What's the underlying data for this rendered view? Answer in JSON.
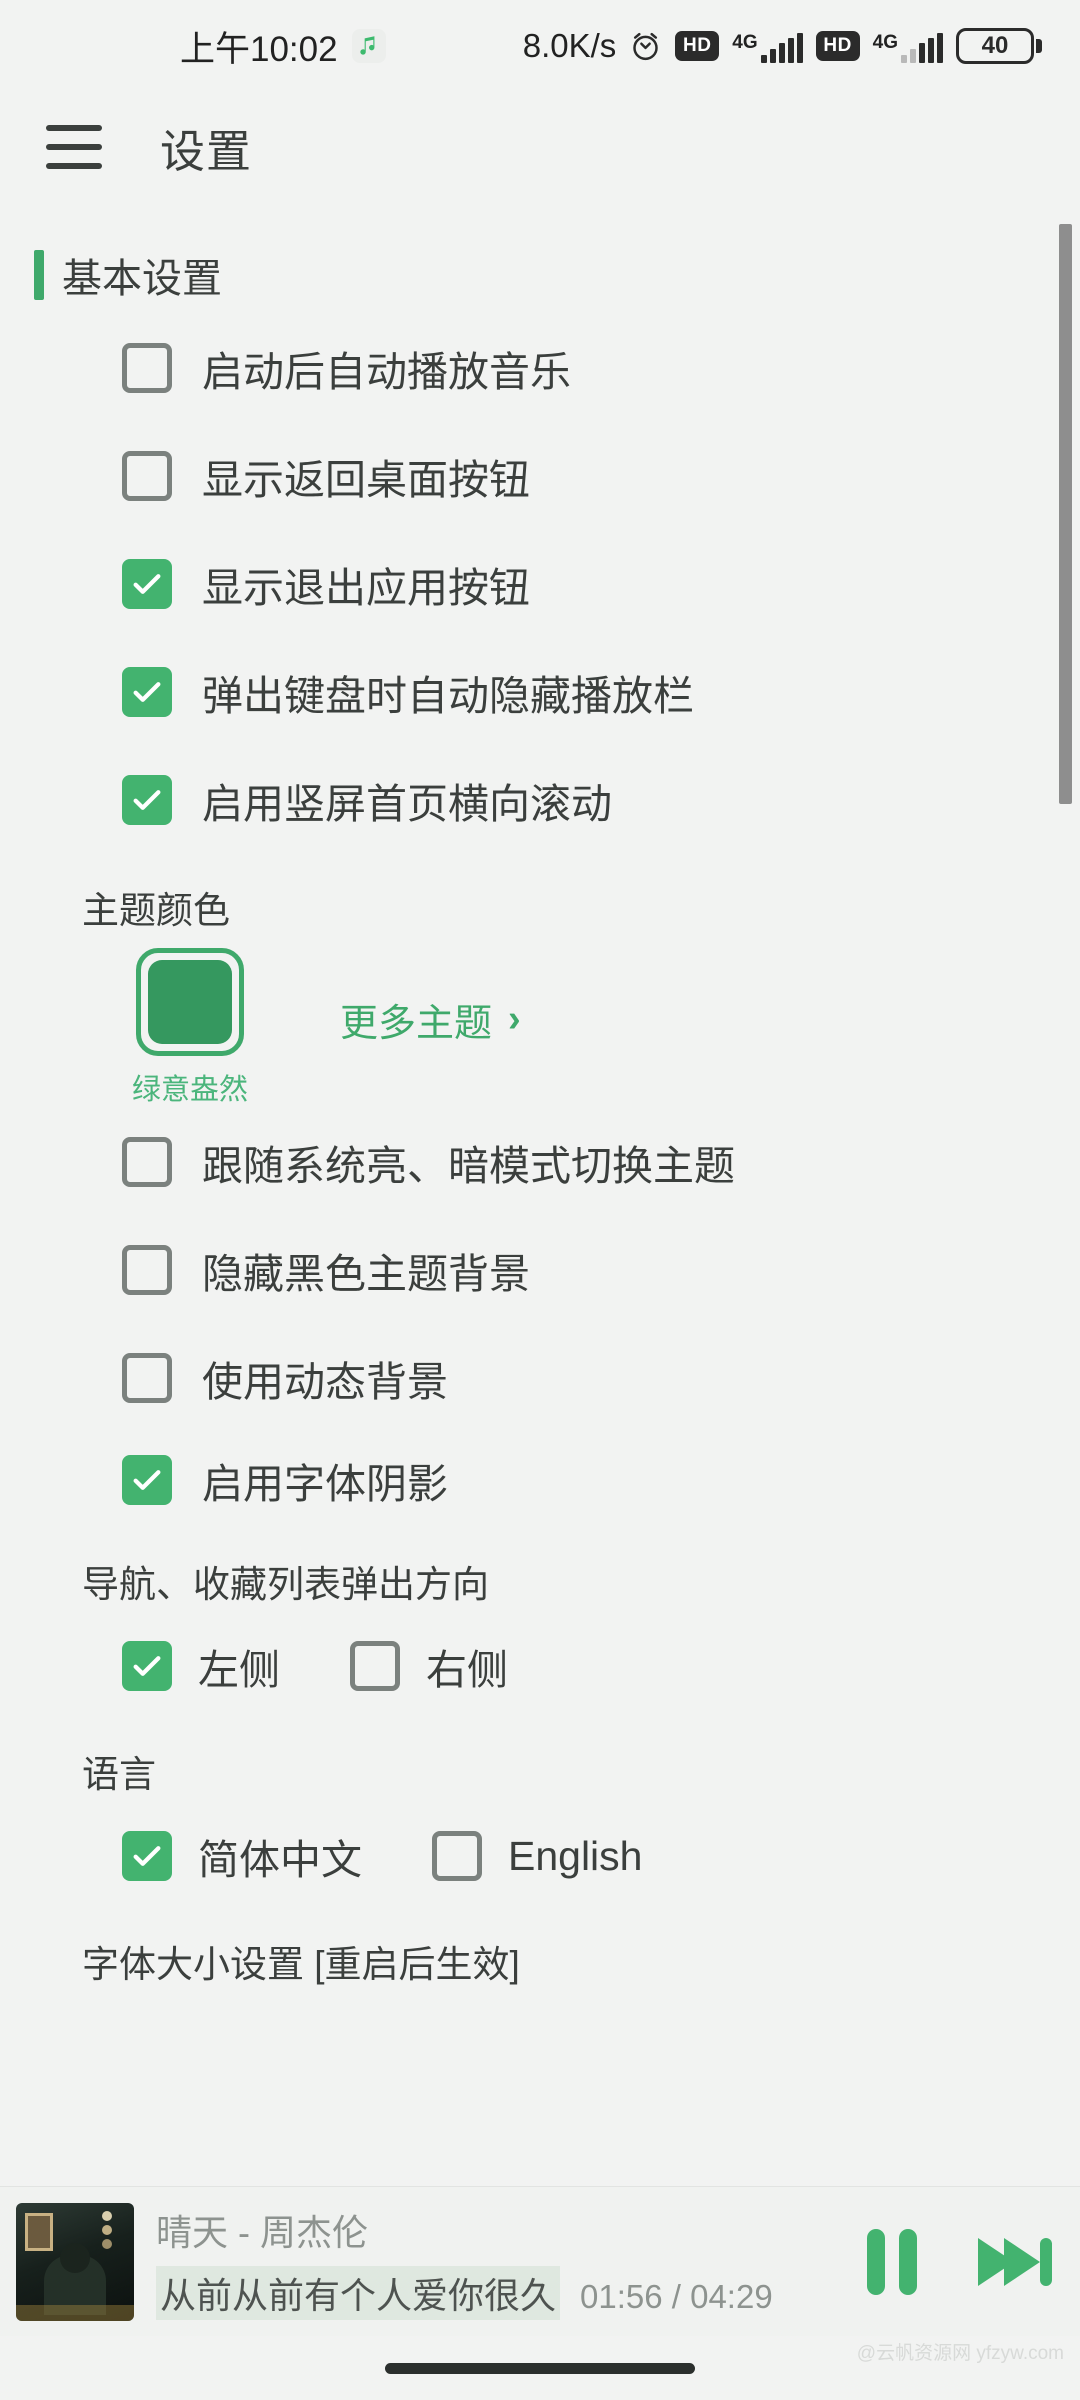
{
  "statusbar": {
    "time": "上午10:02",
    "music_icon": "music-note-icon",
    "net_speed": "8.0K/s",
    "alarm_icon": "alarm-clock-icon",
    "sim1_hd": "HD",
    "sim1_network": "4G",
    "sim2_hd": "HD",
    "sim2_network": "4G",
    "battery_level": "40"
  },
  "appbar": {
    "menu_icon": "hamburger-menu-icon",
    "title": "设置"
  },
  "section": {
    "title": "基本设置"
  },
  "basic_items": [
    {
      "label": "启动后自动播放音乐",
      "checked": false
    },
    {
      "label": "显示返回桌面按钮",
      "checked": false
    },
    {
      "label": "显示退出应用按钮",
      "checked": true
    },
    {
      "label": "弹出键盘时自动隐藏播放栏",
      "checked": true
    },
    {
      "label": "启用竖屏首页横向滚动",
      "checked": true
    }
  ],
  "theme": {
    "group_label": "主题颜色",
    "swatch_color": "#35985f",
    "swatch_name": "绿意盎然",
    "more_label": "更多主题",
    "chevron": "›"
  },
  "theme_items": [
    {
      "label": "跟随系统亮、暗模式切换主题",
      "checked": false
    },
    {
      "label": "隐藏黑色主题背景",
      "checked": false
    },
    {
      "label": "使用动态背景",
      "checked": false
    },
    {
      "label": "启用字体阴影",
      "checked": true
    }
  ],
  "popup_direction": {
    "group_label": "导航、收藏列表弹出方向",
    "options": [
      {
        "label": "左侧",
        "checked": true
      },
      {
        "label": "右侧",
        "checked": false
      }
    ]
  },
  "language": {
    "group_label": "语言",
    "options": [
      {
        "label": "简体中文",
        "checked": true
      },
      {
        "label": "English",
        "checked": false
      }
    ]
  },
  "font_size": {
    "group_label": "字体大小设置 [重启后生效]"
  },
  "player": {
    "album_art": "album-cover-art",
    "track": "晴天 - 周杰伦",
    "lyric": "从前从前有个人爱你很久",
    "time": "01:56 / 04:29",
    "pause_icon": "pause-icon",
    "next_icon": "next-track-icon"
  },
  "watermark": "@云帆资源网 yfzyw.com",
  "colors": {
    "accent_green": "#43b36f",
    "theme_green": "#3fa96b",
    "bg": "#f2f3f2",
    "text": "#3b3f3d"
  }
}
